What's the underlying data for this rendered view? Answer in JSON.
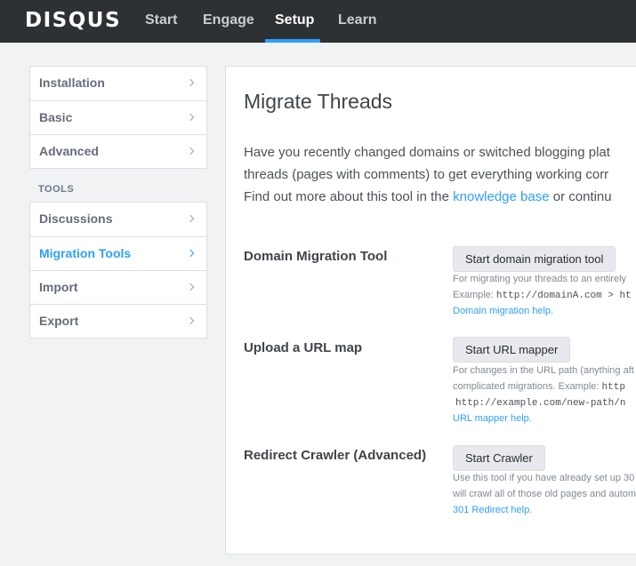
{
  "header": {
    "logo": "DISQUS",
    "nav": [
      {
        "label": "Start"
      },
      {
        "label": "Engage"
      },
      {
        "label": "Setup"
      },
      {
        "label": "Learn"
      }
    ]
  },
  "sidebar": {
    "groups": [
      {
        "items": [
          {
            "label": "Installation"
          },
          {
            "label": "Basic"
          },
          {
            "label": "Advanced"
          }
        ]
      },
      {
        "heading": "TOOLS",
        "items": [
          {
            "label": "Discussions"
          },
          {
            "label": "Migration Tools"
          },
          {
            "label": "Import"
          },
          {
            "label": "Export"
          }
        ]
      }
    ]
  },
  "main": {
    "title": "Migrate Threads",
    "intro": {
      "line1": "Have you recently changed domains or switched blogging plat",
      "line2": "threads (pages with comments) to get everything working corr",
      "line3_pre": "Find out more about this tool in the ",
      "line3_link": "knowledge base",
      "line3_post": " or continu"
    },
    "tools": [
      {
        "title": "Domain Migration Tool",
        "button": "Start domain migration tool",
        "desc1": "For migrating your threads to an entirely",
        "desc2_pre": "Example: ",
        "desc2_mono": "http://domainA.com > ht",
        "help": "Domain migration help."
      },
      {
        "title": "Upload a URL map",
        "button": "Start URL mapper",
        "desc1": "For changes in the URL path (anything aft",
        "desc2_pre": "complicated migrations. Example: ",
        "desc2_mono": "http",
        "desc3_mono": "http://example.com/new-path/n",
        "help": "URL mapper help."
      },
      {
        "title": "Redirect Crawler (Advanced)",
        "button": "Start Crawler",
        "desc1": "Use this tool if you have already set up 30",
        "desc2": "will crawl all of those old pages and autom",
        "help": "301 Redirect help."
      }
    ]
  }
}
